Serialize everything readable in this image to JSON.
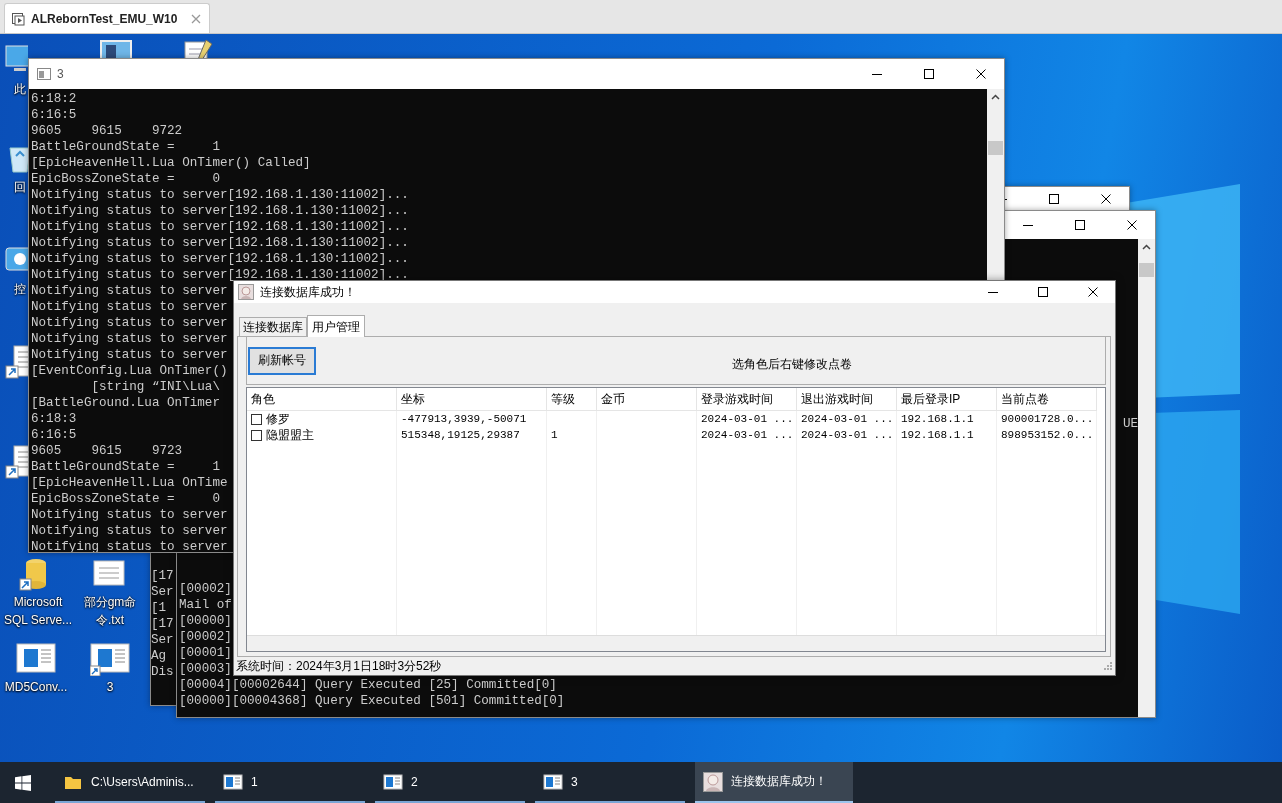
{
  "vm_tab": {
    "title": "ALRebornTest_EMU_W10",
    "selected": true
  },
  "desktop_icons": [
    {
      "kind": "pc",
      "label": "此"
    },
    {
      "kind": "monitor"
    },
    {
      "kind": "notepad"
    },
    {
      "kind": "recycle",
      "label": "回"
    },
    {
      "kind": "control",
      "label": "控"
    },
    {
      "kind": "shortcut"
    },
    {
      "kind": "shortcut"
    },
    {
      "kind": "database",
      "label": "Microsoft SQL Serve..."
    },
    {
      "kind": "text_file",
      "label": "部分gm命令.txt"
    },
    {
      "kind": "console_app",
      "label": "MD5Conv..."
    },
    {
      "kind": "console_shortcut",
      "label": "3"
    }
  ],
  "console_windows": [
    {
      "lines": [
        "[17",
        "Ser",
        "[1",
        "[17",
        "Ser",
        "Ag",
        "Dis"
      ]
    },
    {
      "edge_text": "UE",
      "lines": [
        "[00002]",
        "Mail of",
        "[00000]",
        "[00002]",
        "[00001]",
        "[00003]",
        "[00004][00002644] Query Executed [25] Committed[0]",
        "[00000][00004368] Query Executed [501] Committed[0]"
      ]
    },
    {
      "title": "3",
      "lines": [
        "6:18:2",
        "6:16:5",
        "9605    9615    9722",
        "BattleGroundState =     1",
        "[EpicHeavenHell.Lua OnTimer() Called]",
        "EpicBossZoneState =     0",
        "Notifying status to server[192.168.1.130:11002]...",
        "Notifying status to server[192.168.1.130:11002]...",
        "Notifying status to server[192.168.1.130:11002]...",
        "Notifying status to server[192.168.1.130:11002]...",
        "Notifying status to server[192.168.1.130:11002]...",
        "Notifying status to server[192.168.1.130:11002]...",
        "Notifying status to server",
        "Notifying status to server",
        "Notifying status to server",
        "Notifying status to server",
        "Notifying status to server",
        "[EventConfig.Lua OnTimer()",
        "        [string “INI\\Lua\\",
        "[BattleGround.Lua OnTimer",
        "6:18:3",
        "6:16:5",
        "9605    9615    9723",
        "BattleGroundState =     1",
        "[EpicHeavenHell.Lua OnTime",
        "EpicBossZoneState =     0",
        "Notifying status to server",
        "Notifying status to server",
        "Notifying status to server"
      ]
    }
  ],
  "dialog": {
    "title": "连接数据库成功！",
    "tabs": [
      {
        "label": "连接数据库",
        "selected": false
      },
      {
        "label": "用户管理",
        "selected": true
      }
    ],
    "refresh_button": "刷新帐号",
    "hint": "选角色后右键修改点卷",
    "table": {
      "columns": [
        "角色",
        "坐标",
        "等级",
        "金币",
        "登录游戏时间",
        "退出游戏时间",
        "最后登录IP",
        "当前点卷"
      ],
      "rows": [
        {
          "checked": false,
          "cells": [
            "修罗",
            "-477913,3939,-50071",
            null,
            null,
            "2024-03-01 ...",
            "2024-03-01 ...",
            "192.168.1.1",
            "900001728.0..."
          ]
        },
        {
          "checked": false,
          "cells": [
            "隐盟盟主",
            "515348,19125,29387",
            "1",
            null,
            "2024-03-01 ...",
            "2024-03-01 ...",
            "192.168.1.1",
            "898953152.0..."
          ]
        }
      ]
    },
    "status": "系统时间：2024年3月1日18时3分52秒"
  },
  "taskbar": {
    "items": [
      {
        "kind": "folder",
        "label": "C:\\Users\\Adminis...",
        "active": false
      },
      {
        "kind": "console",
        "label": "1",
        "active": false
      },
      {
        "kind": "console",
        "label": "2",
        "active": false
      },
      {
        "kind": "console",
        "label": "3",
        "active": false
      },
      {
        "kind": "dialog",
        "label": "连接数据库成功！",
        "active": true
      }
    ]
  }
}
